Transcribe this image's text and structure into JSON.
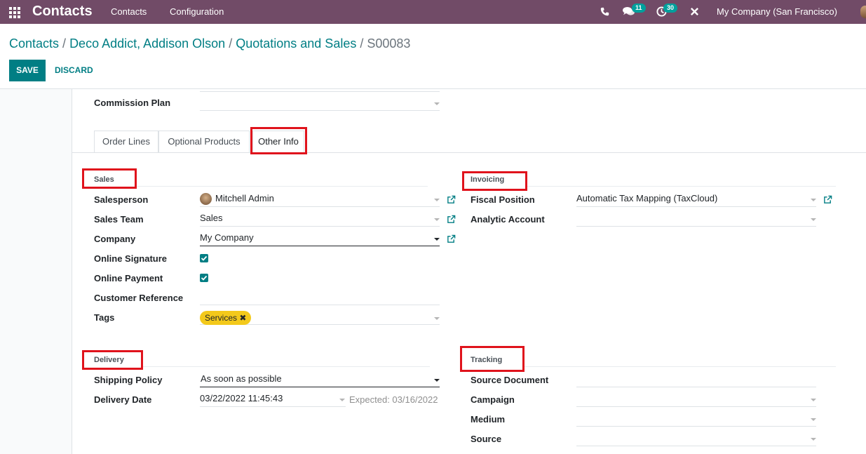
{
  "navbar": {
    "app_name": "Contacts",
    "menu": [
      "Contacts",
      "Configuration"
    ],
    "messages_count": "11",
    "activities_count": "30",
    "company": "My Company (San Francisco)"
  },
  "breadcrumb": [
    "Contacts",
    "Deco Addict, Addison Olson",
    "Quotations and Sales",
    "S00083"
  ],
  "buttons": {
    "save": "SAVE",
    "discard": "DISCARD"
  },
  "commission": {
    "label": "Commission Plan",
    "value": ""
  },
  "tabs": [
    "Order Lines",
    "Optional Products",
    "Other Info"
  ],
  "sales": {
    "title": "Sales",
    "salesperson_label": "Salesperson",
    "salesperson": "Mitchell Admin",
    "team_label": "Sales Team",
    "team": "Sales",
    "company_label": "Company",
    "company": "My Company",
    "signature_label": "Online Signature",
    "signature_checked": true,
    "payment_label": "Online Payment",
    "payment_checked": true,
    "reference_label": "Customer Reference",
    "reference": "",
    "tags_label": "Tags",
    "tag": "Services"
  },
  "invoicing": {
    "title": "Invoicing",
    "fiscal_label": "Fiscal Position",
    "fiscal": "Automatic Tax Mapping (TaxCloud)",
    "analytic_label": "Analytic Account",
    "analytic": ""
  },
  "delivery": {
    "title": "Delivery",
    "policy_label": "Shipping Policy",
    "policy": "As soon as possible",
    "date_label": "Delivery Date",
    "date": "03/22/2022 11:45:43",
    "expected": "Expected: 03/16/2022"
  },
  "tracking": {
    "title": "Tracking",
    "source_doc_label": "Source Document",
    "campaign_label": "Campaign",
    "medium_label": "Medium",
    "source_label": "Source"
  },
  "colors": {
    "navbar": "#714B67",
    "primary": "#017e84",
    "highlight": "#e0131c",
    "tag": "#f3c91b"
  }
}
